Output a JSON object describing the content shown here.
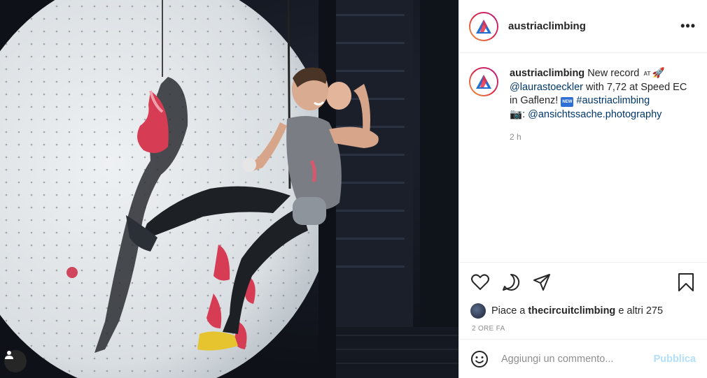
{
  "post": {
    "username": "austriaclimbing",
    "more_label": "•••"
  },
  "caption": {
    "username": "austriaclimbing",
    "text_1": "New record",
    "at_badge": "AT",
    "emoji_1": "🚀",
    "mention_1": "@laurastoeckler",
    "text_2": "with 7,72 at Speed EC in Gaflenz!",
    "new_badge": "NEW",
    "hashtag": "#austriaclimbing",
    "emoji_2": "📷",
    "colon": ":",
    "mention_2": "@ansichtssache.photography",
    "time": "2 h"
  },
  "likes": {
    "prefix": "Piace a",
    "liker": "thecircuitclimbing",
    "suffix": "e altri 275"
  },
  "timestamp": "2 ORE FA",
  "comment": {
    "placeholder": "Aggiungi un commento...",
    "publish_label": "Pubblica"
  },
  "icons": {
    "like": "heart-icon",
    "comment": "comment-icon",
    "share": "share-icon",
    "save": "bookmark-icon",
    "emoji": "emoji-icon",
    "tag": "user-tag-icon"
  },
  "colors": {
    "link": "#00376b",
    "muted": "#8e8e8e",
    "publish_disabled": "#b2dffc",
    "logo_blue": "#1f6fd1",
    "logo_red": "#e8304a"
  }
}
